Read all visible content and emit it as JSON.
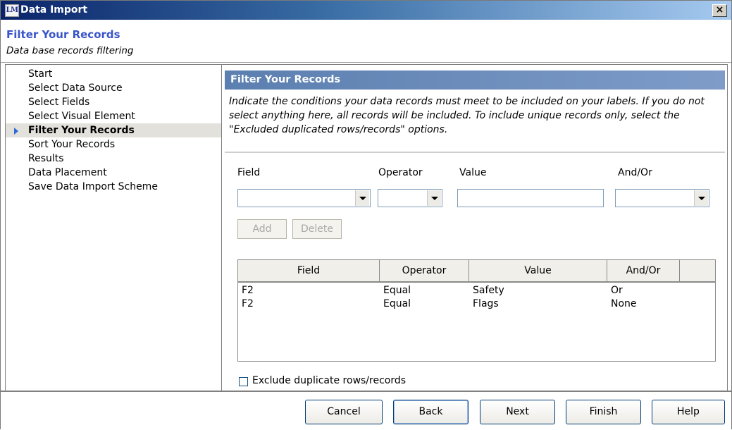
{
  "window": {
    "icon_text": "LM",
    "title": "Data Import",
    "close_label": "×"
  },
  "header": {
    "title": "Filter Your Records",
    "subtitle": "Data base records filtering"
  },
  "nav": {
    "items": [
      {
        "label": "Start"
      },
      {
        "label": "Select Data Source"
      },
      {
        "label": "Select Fields"
      },
      {
        "label": "Select Visual Element"
      },
      {
        "label": "Filter Your Records",
        "active": true
      },
      {
        "label": "Sort Your Records"
      },
      {
        "label": "Results"
      },
      {
        "label": "Data Placement"
      },
      {
        "label": "Save Data Import Scheme"
      }
    ]
  },
  "main": {
    "section_title": "Filter Your Records",
    "description": "Indicate the conditions your data records must meet to be included on your labels. If you do not select anything here, all records will be included. To include unique records only, select the \"Excluded duplicated rows/records\" options.",
    "labels": {
      "field": "Field",
      "operator": "Operator",
      "value": "Value",
      "andor": "And/Or"
    },
    "inputs": {
      "field_value": "",
      "operator_value": "",
      "value_value": "",
      "andor_value": ""
    },
    "add_label": "Add",
    "delete_label": "Delete",
    "table": {
      "columns": [
        "Field",
        "Operator",
        "Value",
        "And/Or",
        ""
      ],
      "rows": [
        [
          "F2",
          "Equal",
          "Safety",
          "Or"
        ],
        [
          "F2",
          "Equal",
          "Flags",
          "None"
        ]
      ]
    },
    "exclude_duplicates": {
      "label": "Exclude duplicate rows/records",
      "checked": false
    }
  },
  "footer": {
    "cancel": "Cancel",
    "back": "Back",
    "next": "Next",
    "finish": "Finish",
    "help": "Help"
  }
}
